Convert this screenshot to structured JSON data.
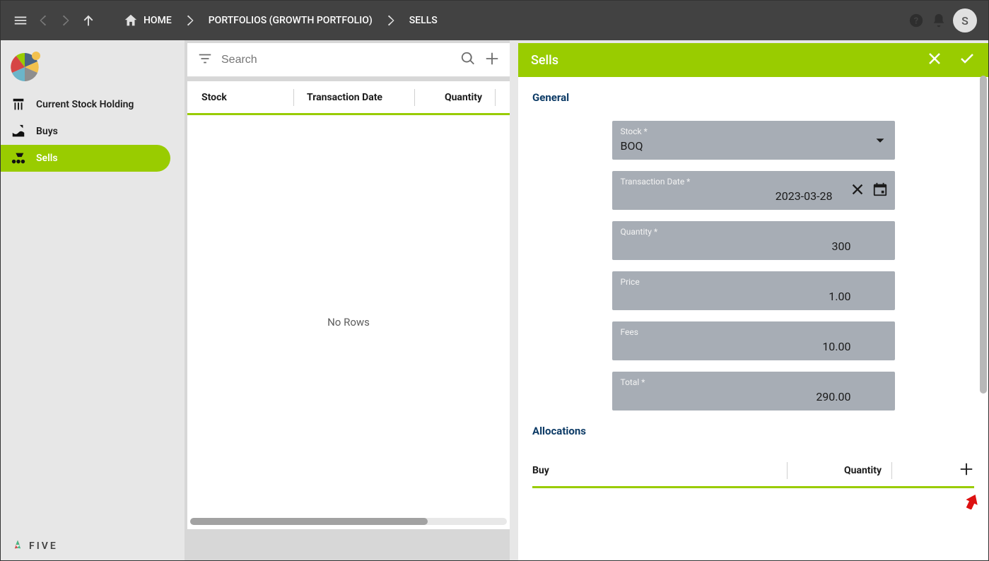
{
  "topbar": {
    "home": "HOME",
    "portfolios": "PORTFOLIOS (GROWTH PORTFOLIO)",
    "sells": "SELLS",
    "avatar": "S"
  },
  "sidebar": {
    "items": [
      {
        "label": "Current Stock Holding"
      },
      {
        "label": "Buys"
      },
      {
        "label": "Sells"
      }
    ],
    "brand": "FIVE"
  },
  "list": {
    "search_placeholder": "Search",
    "col_stock": "Stock",
    "col_date": "Transaction Date",
    "col_qty": "Quantity",
    "empty": "No Rows"
  },
  "detail": {
    "title": "Sells",
    "general": "General",
    "fields": {
      "stock_label": "Stock *",
      "stock_value": "BOQ",
      "date_label": "Transaction Date *",
      "date_value": "2023-03-28",
      "qty_label": "Quantity *",
      "qty_value": "300",
      "price_label": "Price",
      "price_value": "1.00",
      "fees_label": "Fees",
      "fees_value": "10.00",
      "total_label": "Total *",
      "total_value": "290.00"
    },
    "allocations": "Allocations",
    "alloc_col_buy": "Buy",
    "alloc_col_qty": "Quantity"
  }
}
